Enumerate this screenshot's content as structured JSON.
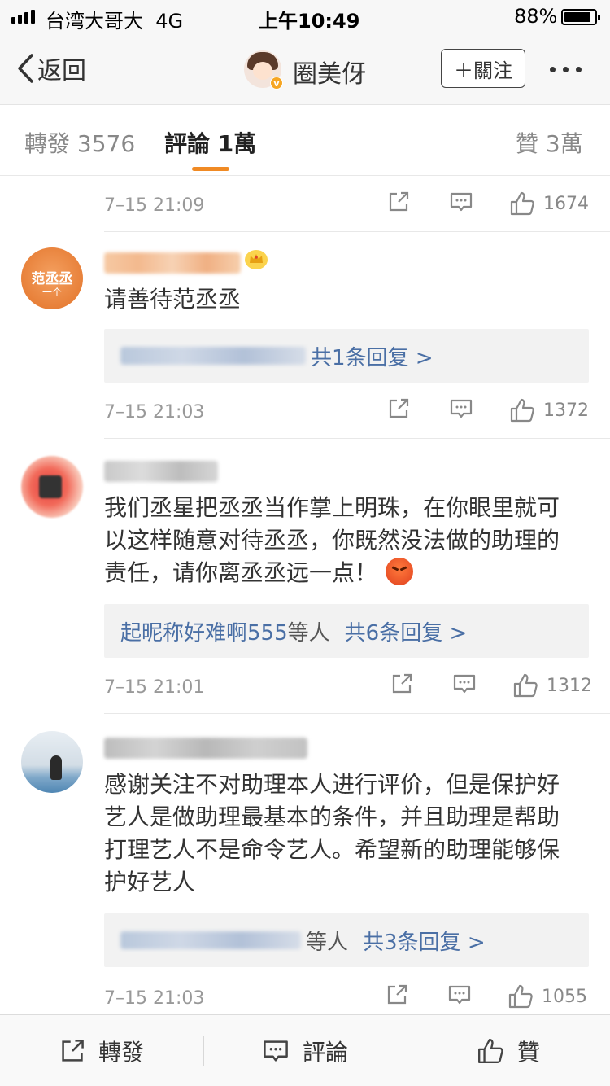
{
  "status_bar": {
    "carrier": "台湾大哥大",
    "network": "4G",
    "time": "上午10:49",
    "battery": "88%",
    "battery_level": 0.88
  },
  "nav": {
    "back_label": "返回",
    "title": "圈美伢",
    "follow_label": "＋關注"
  },
  "tabs": {
    "repost": "轉發 3576",
    "comments": "評論 1萬",
    "likes": "贊 3萬"
  },
  "comments": [
    {
      "date": "7–15 21:09",
      "likes": "1674"
    },
    {
      "date": "7–15 21:03",
      "likes": "1372",
      "text": "请善待范丞丞",
      "avatar_text": "范丞丞",
      "avatar_sub": "一个",
      "reply_count": "共1条回复 >"
    },
    {
      "date": "7–15 21:01",
      "likes": "1312",
      "text": "我们丞星把丞丞当作掌上明珠，在你眼里就可以这样随意对待丞丞，你既然没法做的助理的责任，请你离丞丞远一点！",
      "reply_name": "起昵称好难啊555",
      "reply_suffix": "等人",
      "reply_count": "共6条回复 >"
    },
    {
      "date": "7–15 21:03",
      "likes": "1055",
      "text": "感谢关注不对助理本人进行评价，但是保护好艺人是做助理最基本的条件，并且助理是帮助打理艺人不是命令艺人。希望新的助理能够保护好艺人",
      "reply_suffix": "等人",
      "reply_count": "共3条回复 >"
    }
  ],
  "bottom_bar": {
    "repost": "轉發",
    "comment": "評論",
    "like": "贊"
  }
}
